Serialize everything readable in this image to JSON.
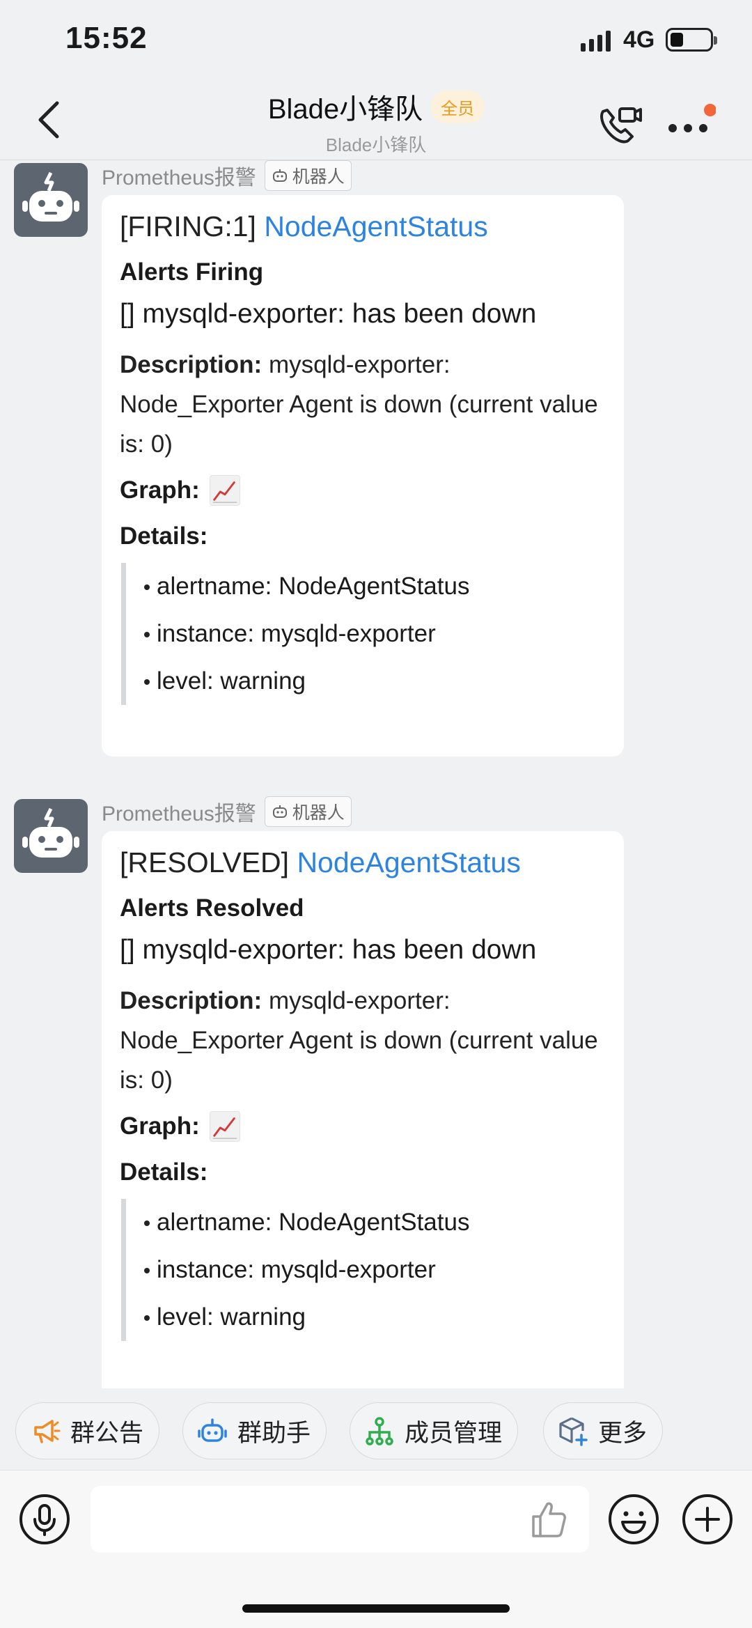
{
  "status_bar": {
    "time": "15:52",
    "network": "4G"
  },
  "header": {
    "title": "Blade小锋队",
    "badge": "全员",
    "subtitle": "Blade小锋队"
  },
  "messages": [
    {
      "sender": "Prometheus报警",
      "tag": "机器人",
      "title_prefix": "[FIRING:1]",
      "title_link": "NodeAgentStatus",
      "section": "Alerts Firing",
      "alert_line": "[] mysqld-exporter: has been down",
      "description_label": "Description:",
      "description_text": "mysqld-exporter: Node_Exporter Agent is down (current value is: 0)",
      "graph_label": "Graph:",
      "details_label": "Details:",
      "details": [
        "alertname: NodeAgentStatus",
        "instance: mysqld-exporter",
        "level: warning"
      ]
    },
    {
      "sender": "Prometheus报警",
      "tag": "机器人",
      "title_prefix": "[RESOLVED]",
      "title_link": "NodeAgentStatus",
      "section": "Alerts Resolved",
      "alert_line": "[] mysqld-exporter: has been down",
      "description_label": "Description:",
      "description_text": "mysqld-exporter: Node_Exporter Agent is down (current value is: 0)",
      "graph_label": "Graph:",
      "details_label": "Details:",
      "details": [
        "alertname: NodeAgentStatus",
        "instance: mysqld-exporter",
        "level: warning"
      ]
    }
  ],
  "shortcuts": [
    {
      "label": "群公告",
      "icon": "megaphone-icon",
      "color": "#f08a24"
    },
    {
      "label": "群助手",
      "icon": "robot-icon",
      "color": "#2d84e0"
    },
    {
      "label": "成员管理",
      "icon": "org-chart-icon",
      "color": "#2fae4f"
    },
    {
      "label": "更多",
      "icon": "cube-plus-icon",
      "color": "#2d84e0"
    }
  ],
  "input": {
    "placeholder": ""
  },
  "colors": {
    "link": "#2d84e0",
    "badge_text": "#e79a1b",
    "notify_dot": "#f2663b",
    "avatar_bg": "#5c6570"
  }
}
